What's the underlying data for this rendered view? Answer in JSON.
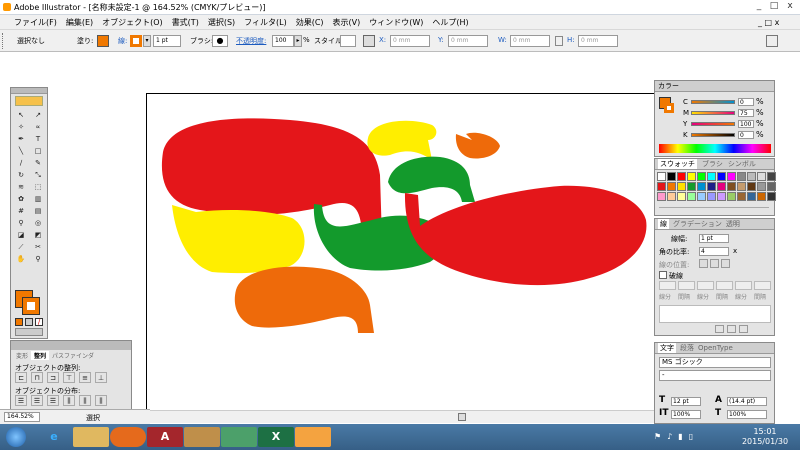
{
  "window": {
    "title": "Adobe Illustrator - [名称未設定-1 @ 164.52% (CMYK/プレビュー)]",
    "min": "_",
    "max": "□",
    "close": "x"
  },
  "menu": [
    "ファイル(F)",
    "編集(E)",
    "オブジェクト(O)",
    "書式(T)",
    "選択(S)",
    "フィルタ(L)",
    "効果(C)",
    "表示(V)",
    "ウィンドウ(W)",
    "ヘルプ(H)"
  ],
  "control": {
    "selection": "選択なし",
    "fill_label": "塗り:",
    "stroke_label": "線:",
    "stroke_weight": "1 pt",
    "brush_label": "ブラシ:",
    "opacity_label": "不透明度:",
    "opacity_value": "100",
    "opacity_unit": "%",
    "style_label": "スタイル:",
    "x_label": "X:",
    "x_value": "0 mm",
    "y_label": "Y:",
    "y_value": "0 mm",
    "w_label": "W:",
    "w_value": "0 mm",
    "h_label": "H:",
    "h_value": "0 mm",
    "fill_color": "#f07800",
    "stroke_color": "#f07800"
  },
  "align_panel": {
    "tabs": [
      "変形",
      "整列",
      "パスファインダ"
    ],
    "section1": "オブジェクトの整列:",
    "section2": "オブジェクトの分布:"
  },
  "color_panel": {
    "title": "カラー",
    "channels": [
      {
        "label": "C",
        "value": "0",
        "unit": "%"
      },
      {
        "label": "M",
        "value": "75",
        "unit": "%"
      },
      {
        "label": "Y",
        "value": "100",
        "unit": "%"
      },
      {
        "label": "K",
        "value": "0",
        "unit": "%"
      }
    ]
  },
  "swatch_panel": {
    "tabs": [
      "スウォッチ",
      "ブラシ",
      "シンボル"
    ]
  },
  "stroke_panel": {
    "tabs": [
      "線",
      "グラデーション",
      "透明"
    ],
    "weight_label": "線幅:",
    "weight_value": "1 pt",
    "miter_label": "角の比率:",
    "miter_value": "4",
    "miter_unit": "x",
    "align_label": "線の位置:",
    "dashed_label": "破線",
    "dash_labels": [
      "線分",
      "間隔",
      "線分",
      "間隔",
      "線分",
      "間隔"
    ]
  },
  "char_panel": {
    "tabs": [
      "文字",
      "段落",
      "OpenType"
    ],
    "font": "MS ゴシック",
    "style": "-",
    "size": "12 pt",
    "leading": "(14.4 pt)",
    "hscale": "100%",
    "vscale": "100%"
  },
  "status": {
    "zoom": "164.52%",
    "mode": "選択"
  },
  "clock": {
    "time": "15:01",
    "date": "2015/01/30"
  },
  "taskbar_apps": [
    "ie",
    "explorer",
    "firefox",
    "access",
    "tool",
    "network",
    "excel",
    "illustrator"
  ]
}
